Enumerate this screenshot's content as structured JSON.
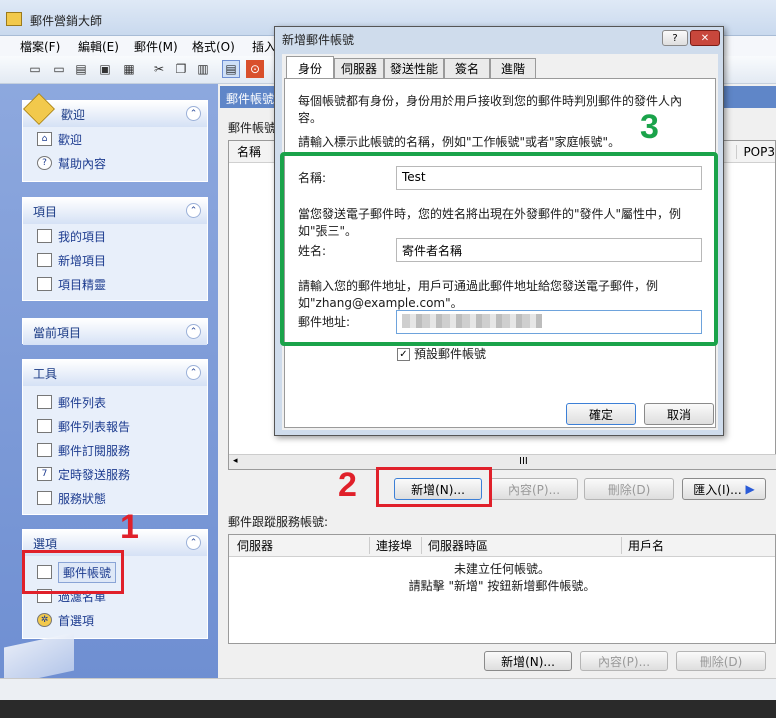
{
  "window": {
    "title": "郵件營銷大師"
  },
  "menu": [
    "檔案(F)",
    "編輯(E)",
    "郵件(M)",
    "格式(O)",
    "插入"
  ],
  "left": {
    "welcome": {
      "title": "歡迎",
      "items": [
        "歡迎",
        "幫助內容"
      ]
    },
    "project": {
      "title": "項目",
      "items": [
        "我的項目",
        "新增項目",
        "項目精靈"
      ]
    },
    "current": {
      "title": "當前項目"
    },
    "tools": {
      "title": "工具",
      "items": [
        "郵件列表",
        "郵件列表報告",
        "郵件訂閱服務",
        "定時發送服務",
        "服務狀態"
      ]
    },
    "options": {
      "title": "選項",
      "items": [
        "郵件帳號",
        "過濾名單",
        "首選項"
      ]
    }
  },
  "main": {
    "section_title": "郵件帳號",
    "accounts_label": "郵件帳號",
    "col_name": "名稱",
    "col_pop3": "POP3",
    "scroll_mid": "III",
    "buttons": {
      "new": "新增(N)...",
      "props": "內容(P)...",
      "delete": "刪除(D)",
      "import": "匯入(I)...",
      "more": "▶"
    },
    "tracking_label": "郵件跟蹤服務帳號:",
    "tracking_cols": [
      "伺服器",
      "連接埠",
      "伺服器時區",
      "用戶名"
    ],
    "empty_line1": "未建立任何帳號。",
    "empty_line2": "請點擊 \"新增\" 按鈕新增郵件帳號。",
    "bottom_buttons": {
      "new": "新增(N)...",
      "props": "內容(P)...",
      "delete": "刪除(D)"
    }
  },
  "dialog": {
    "title": "新增郵件帳號",
    "tabs": [
      "身份",
      "伺服器",
      "發送性能",
      "簽名",
      "進階"
    ],
    "intro": "每個帳號都有身份，身份用於用戶接收到您的郵件時判別郵件的發件人內容。",
    "name_prompt": "請輸入標示此帳號的名稱，例如\"工作帳號\"或者\"家庭帳號\"。",
    "name_label": "名稱:",
    "name_value": "Test",
    "sender_prompt": "當您發送電子郵件時，您的姓名將出現在外發郵件的\"發件人\"屬性中，例如\"張三\"。",
    "sender_label": "姓名:",
    "sender_value": "寄件者名稱",
    "email_prompt": "請輸入您的郵件地址，用戶可通過此郵件地址給您發送電子郵件，例如\"zhang@example.com\"。",
    "email_label": "郵件地址:",
    "default_label": "預設郵件帳號",
    "ok": "確定",
    "cancel": "取消"
  },
  "annotations": {
    "step1": "1",
    "step2": "2",
    "step3": "3"
  },
  "colors": {
    "red": "#e0202a",
    "green": "#1aa34a"
  }
}
